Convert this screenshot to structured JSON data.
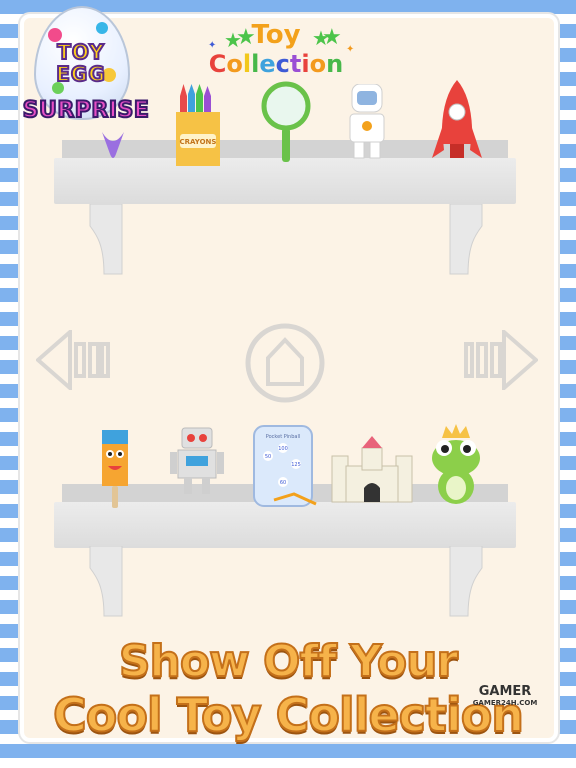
{
  "logo": {
    "line1": "TOY",
    "line2": "EGG",
    "line3": "SURPRISE"
  },
  "title": {
    "line1": "Toy",
    "line2_letters": [
      "C",
      "o",
      "l",
      "l",
      "e",
      "c",
      "t",
      "i",
      "o",
      "n"
    ],
    "line2_colors": [
      "#e8423c",
      "#f39a1e",
      "#f2c81b",
      "#47b84a",
      "#3fa2dd",
      "#3f5bd6",
      "#9a4fd4",
      "#e8423c",
      "#f39a1e",
      "#47b84a"
    ]
  },
  "shelf1": {
    "toys": [
      "ice-cream-cone",
      "crayons-box",
      "magnifying-glass",
      "astronaut",
      "rocket"
    ],
    "crayons_label": "CRAYONS"
  },
  "shelf2": {
    "toys": [
      "popsicle-monster",
      "robot",
      "pocket-pinball",
      "castle",
      "frog-prince"
    ],
    "pinball": {
      "title": "Pocket Pinball",
      "scores": [
        "100",
        "50",
        "125",
        "60"
      ]
    }
  },
  "nav": {
    "prev": "prev-arrow-icon",
    "home": "home-icon",
    "next": "next-arrow-icon"
  },
  "footer": {
    "line1": "Show Off Your",
    "line2": "Cool Toy Collection"
  },
  "watermark": {
    "brand": "GAMER",
    "sub": "GAMER24H.COM"
  },
  "colors": {
    "background_stripe": "#7fb2ee",
    "panel": "#fcf3e6",
    "shelf": "#e5e5e5",
    "footer_text": "#f6b34a"
  }
}
